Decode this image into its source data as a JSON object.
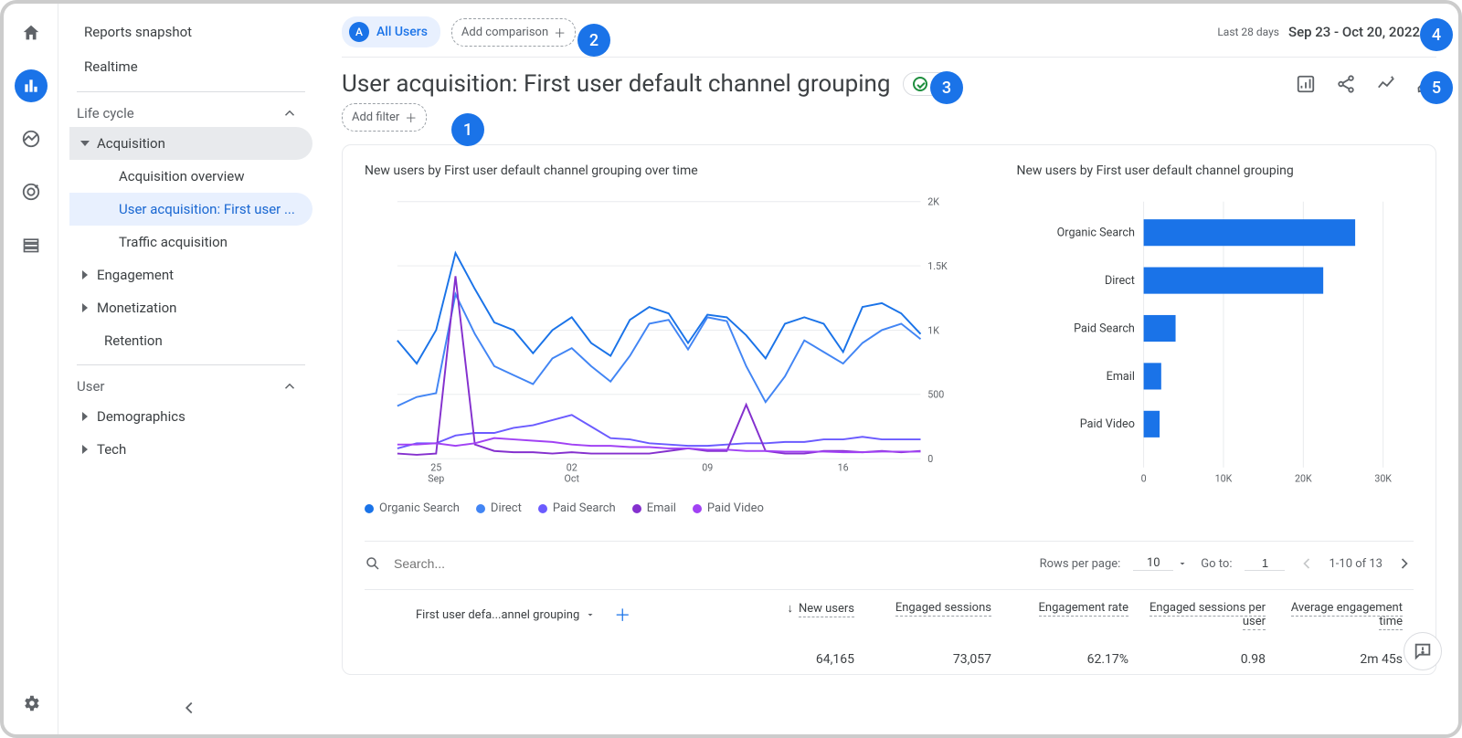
{
  "rail": {
    "icons": [
      "home",
      "reports",
      "explore",
      "advertising",
      "configure"
    ],
    "selected": "reports"
  },
  "side": {
    "top": [
      "Reports snapshot",
      "Realtime"
    ],
    "groups": [
      {
        "label": "Life cycle",
        "expanded": true,
        "items": [
          {
            "label": "Acquisition",
            "expanded": true,
            "children": [
              {
                "label": "Acquisition overview"
              },
              {
                "label": "User acquisition: First user ...",
                "active": true
              },
              {
                "label": "Traffic acquisition"
              }
            ]
          },
          {
            "label": "Engagement",
            "expanded": false
          },
          {
            "label": "Monetization",
            "expanded": false
          },
          {
            "label": "Retention",
            "leaf": true
          }
        ]
      },
      {
        "label": "User",
        "expanded": true,
        "items": [
          {
            "label": "Demographics",
            "expanded": false
          },
          {
            "label": "Tech",
            "expanded": false
          }
        ]
      }
    ]
  },
  "top": {
    "segment_badge": "A",
    "segment_label": "All Users",
    "add_comparison": "Add comparison",
    "date_hint": "Last 28 days",
    "date_range": "Sep 23 - Oct 20, 2022"
  },
  "title": "User acquisition: First user default channel grouping",
  "add_filter": "Add filter",
  "action_icons": [
    "insights-icon",
    "share-icon",
    "analytics-intelligence-icon",
    "edit-icon"
  ],
  "coach_numbers": {
    "1": "filter",
    "2": "comparison",
    "3": "status",
    "4": "daterange",
    "5": "edit"
  },
  "chart_data": [
    {
      "type": "line",
      "title": "New users by First user default channel grouping over time",
      "xlabel": "",
      "ylabel": "",
      "ylim": [
        0,
        2000
      ],
      "yticks": [
        0,
        500,
        1000,
        1500,
        2000
      ],
      "xticks": [
        "25 Sep",
        "02 Oct",
        "09",
        "16"
      ],
      "x_days": [
        23,
        24,
        25,
        26,
        27,
        28,
        29,
        30,
        1,
        2,
        3,
        4,
        5,
        6,
        7,
        8,
        9,
        10,
        11,
        12,
        13,
        14,
        15,
        16,
        17,
        18,
        19,
        20
      ],
      "series": [
        {
          "name": "Organic Search",
          "color": "#1a73e8",
          "values": [
            920,
            740,
            1000,
            1600,
            1320,
            1060,
            1000,
            820,
            1000,
            1100,
            900,
            800,
            1080,
            1180,
            1130,
            900,
            1120,
            1100,
            960,
            780,
            1050,
            1100,
            1050,
            830,
            1180,
            1210,
            1130,
            970
          ]
        },
        {
          "name": "Direct",
          "color": "#4285f4",
          "values": [
            410,
            480,
            510,
            1280,
            970,
            720,
            650,
            580,
            780,
            860,
            720,
            600,
            800,
            1050,
            1080,
            850,
            1100,
            1070,
            720,
            440,
            640,
            920,
            830,
            740,
            900,
            1000,
            1050,
            930
          ]
        },
        {
          "name": "Paid Search",
          "color": "#6b5bff",
          "values": [
            80,
            120,
            120,
            180,
            200,
            200,
            240,
            260,
            300,
            340,
            250,
            160,
            150,
            120,
            110,
            100,
            100,
            110,
            120,
            120,
            130,
            130,
            150,
            150,
            170,
            150,
            150,
            150
          ]
        },
        {
          "name": "Email",
          "color": "#8430ce",
          "values": [
            40,
            30,
            40,
            1420,
            110,
            60,
            50,
            50,
            40,
            50,
            40,
            40,
            40,
            40,
            60,
            80,
            60,
            60,
            420,
            60,
            40,
            40,
            60,
            60,
            50,
            60,
            50,
            60
          ]
        },
        {
          "name": "Paid Video",
          "color": "#a142f4",
          "values": [
            110,
            110,
            120,
            100,
            120,
            160,
            150,
            140,
            130,
            110,
            100,
            100,
            90,
            90,
            80,
            80,
            70,
            70,
            60,
            60,
            55,
            55,
            55,
            50,
            50,
            55,
            55,
            55
          ]
        }
      ]
    },
    {
      "type": "bar",
      "title": "New users by First user default channel grouping",
      "orientation": "horizontal",
      "xlabel": "",
      "ylabel": "",
      "xlim": [
        0,
        30000
      ],
      "xticks": [
        0,
        10000,
        20000,
        30000
      ],
      "xtick_labels": [
        "0",
        "10K",
        "20K",
        "30K"
      ],
      "categories": [
        "Organic Search",
        "Direct",
        "Paid Search",
        "Email",
        "Paid Video"
      ],
      "values": [
        26500,
        22500,
        4000,
        2200,
        2000
      ],
      "color": "#1a73e8"
    }
  ],
  "legend": [
    "Organic Search",
    "Direct",
    "Paid Search",
    "Email",
    "Paid Video"
  ],
  "table": {
    "search_placeholder": "Search...",
    "rows_per_page_label": "Rows per page:",
    "rows_per_page": "10",
    "goto_label": "Go to:",
    "goto_value": "1",
    "page_info": "1-10 of 13",
    "primary_dim": "First user defa...annel grouping",
    "columns": [
      "New users",
      "Engaged sessions",
      "Engagement rate",
      "Engaged sessions per user",
      "Average engagement time"
    ],
    "sort_col": 0,
    "totals": [
      "64,165",
      "73,057",
      "62.17%",
      "0.98",
      "2m 45s"
    ]
  }
}
